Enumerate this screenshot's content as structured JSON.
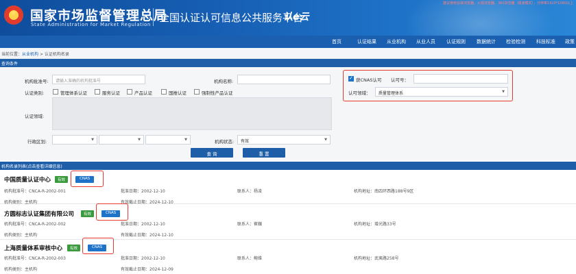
{
  "header": {
    "notice": "建议使用谷歌浏览器、火狐浏览器、360浏览器（极速模式），分辨率1920*1080以上",
    "agency_cn": "国家市场监督管理总局",
    "agency_en": "State Administration for Market Regulation",
    "platform_title": "全国认证认可信息公共服务平台",
    "platform_logo": "认e云"
  },
  "nav": [
    "首页",
    "认证结果",
    "从业机构",
    "从业人员",
    "认证规则",
    "数据统计",
    "检验检测",
    "科技标准",
    "政策"
  ],
  "breadcrumb": {
    "prefix": "当前位置：",
    "level1": "从业机构",
    "sep": " > ",
    "level2": "认证机构名录"
  },
  "query_section": "查询条件",
  "form": {
    "approval_no_label": "机构批准号:",
    "approval_no_placeholder": "请输入准确的机构批准号",
    "org_name_label": "机构名称:",
    "cert_type_label": "认证类别:",
    "cert_types": [
      "管理体系认证",
      "服务认证",
      "产品认证",
      "国推认证",
      "强制性产品认证"
    ],
    "cert_field_label": "认证领域:",
    "region_label": "行政区划:",
    "status_label": "机构状态:",
    "status_value": "有效",
    "cnas_label": "获CNAS认可",
    "accred_no_label": "认可号：",
    "accred_field_label": "认可领域：",
    "accred_field_value": "质量管理体系",
    "query_btn": "查 询",
    "reset_btn": "重 置"
  },
  "list_section": "机构名录列表(点击查看详细信息)",
  "records": [
    {
      "name": "中国质量认证中心",
      "status": "有效",
      "cnas": "CNAS",
      "approval": "机构批准号：CNCA-R-2002-001",
      "approval_date": "批准日期：2002-12-10",
      "contact": "联系人：杨凌",
      "address": "机构地址：南四环西路188号9区",
      "category": "机构类别：主机构",
      "expire": "有效截止日期：2024-12-10"
    },
    {
      "name": "方圆标志认证集团有限公司",
      "status": "有效",
      "cnas": "CNAS",
      "approval": "机构批准号：CNCA-R-2002-002",
      "approval_date": "批准日期：2002-12-10",
      "contact": "联系人：崔巍",
      "address": "机构地址：增光路33号",
      "category": "机构类别：主机构",
      "expire": "有效截止日期：2024-12-10"
    },
    {
      "name": "上海质量体系审核中心",
      "status": "有效",
      "cnas": "CNAS",
      "approval": "机构批准号：CNCA-R-2002-003",
      "approval_date": "批准日期：2002-12-10",
      "contact": "联系人：鲍维",
      "address": "机构地址：武夷路258号",
      "category": "机构类别：主机构",
      "expire": "有效截止日期：2024-12-09"
    }
  ]
}
